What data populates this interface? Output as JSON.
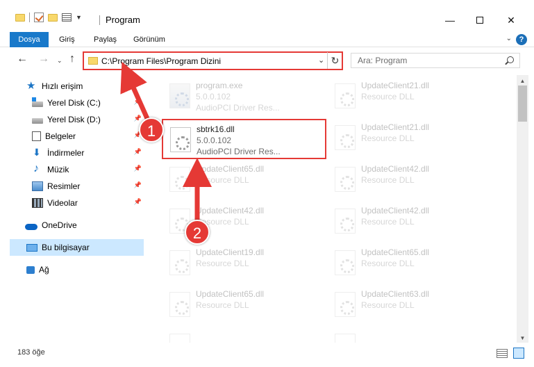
{
  "window": {
    "title": "Program",
    "controls": {
      "minimize": "—",
      "maximize": "",
      "close": "✕"
    }
  },
  "ribbon": {
    "tabs": [
      "Dosya",
      "Giriş",
      "Paylaş",
      "Görünüm"
    ],
    "help": "?"
  },
  "navigation": {
    "address_path": "C:\\Program Files\\Program Dizini",
    "search_placeholder": "Ara: Program"
  },
  "sidebar": {
    "items": [
      {
        "label": "Hızlı erişim",
        "icon": "star-icon"
      },
      {
        "label": "Yerel Disk (C:)",
        "icon": "drive-icon"
      },
      {
        "label": "Yerel Disk (D:)",
        "icon": "drive-icon"
      },
      {
        "label": "Belgeler",
        "icon": "documents-icon"
      },
      {
        "label": "İndirmeler",
        "icon": "download-icon"
      },
      {
        "label": "Müzik",
        "icon": "music-icon"
      },
      {
        "label": "Resimler",
        "icon": "pictures-icon"
      },
      {
        "label": "Videolar",
        "icon": "videos-icon"
      },
      {
        "label": "OneDrive",
        "icon": "cloud-icon"
      },
      {
        "label": "Bu bilgisayar",
        "icon": "computer-icon"
      },
      {
        "label": "Ağ",
        "icon": "network-icon"
      }
    ]
  },
  "files": [
    {
      "name": "program.exe",
      "line2": "5.0.0.102",
      "line3": "AudioPCI Driver Res..."
    },
    {
      "name": "UpdateClient21.dll",
      "line2": "Resource DLL",
      "line3": ""
    },
    {
      "name": "sbtrk16.dll",
      "line2": "5.0.0.102",
      "line3": "AudioPCI Driver Res..."
    },
    {
      "name": "UpdateClient21.dll",
      "line2": "Resource DLL",
      "line3": ""
    },
    {
      "name": "UpdateClient65.dll",
      "line2": "Resource DLL",
      "line3": ""
    },
    {
      "name": "UpdateClient42.dll",
      "line2": "Resource DLL",
      "line3": ""
    },
    {
      "name": "UpdateClient42.dll",
      "line2": "Resource DLL",
      "line3": ""
    },
    {
      "name": "UpdateClient42.dll",
      "line2": "Resource DLL",
      "line3": ""
    },
    {
      "name": "UpdateClient19.dll",
      "line2": "Resource DLL",
      "line3": ""
    },
    {
      "name": "UpdateClient65.dll",
      "line2": "Resource DLL",
      "line3": ""
    },
    {
      "name": "UpdateClient65.dll",
      "line2": "Resource DLL",
      "line3": ""
    },
    {
      "name": "UpdateClient63.dll",
      "line2": "Resource DLL",
      "line3": ""
    }
  ],
  "status": {
    "item_count": "183 öğe"
  },
  "annotations": {
    "step1": "1",
    "step2": "2",
    "color": "#e53935"
  }
}
